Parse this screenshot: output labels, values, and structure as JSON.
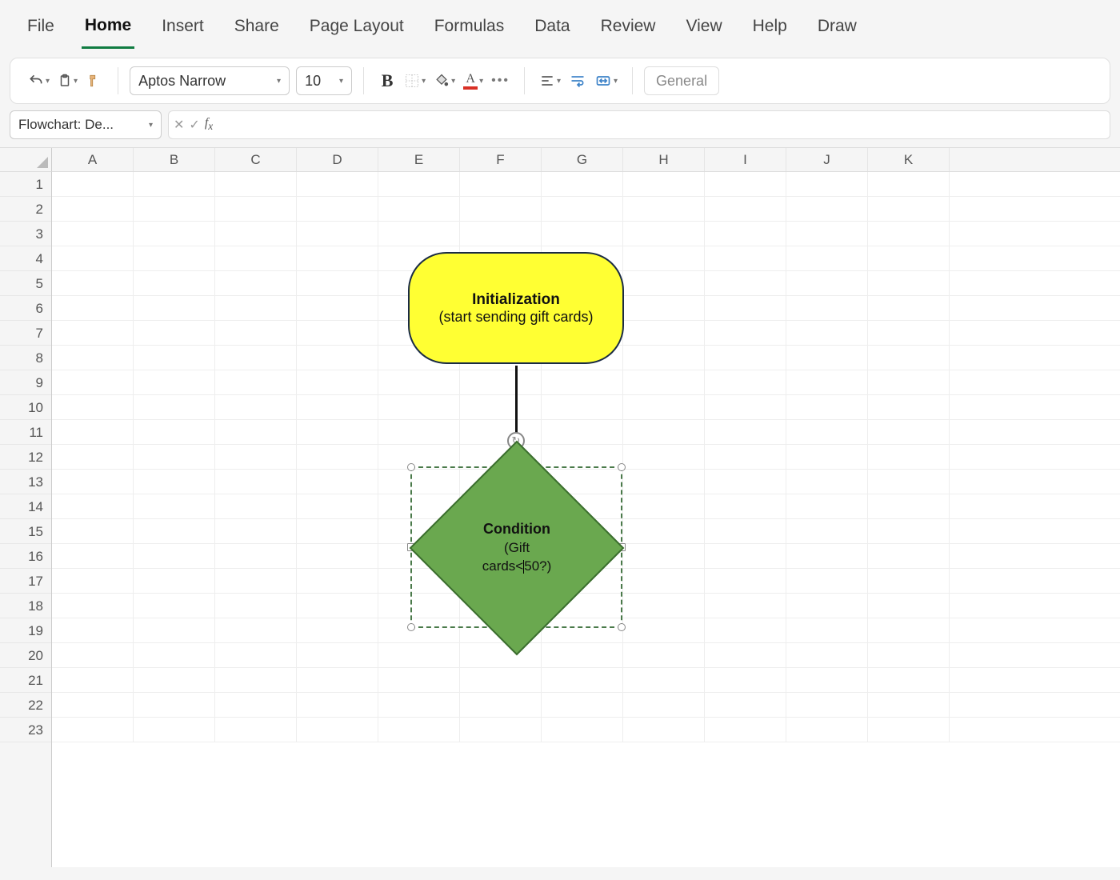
{
  "ribbon": {
    "tabs": [
      "File",
      "Home",
      "Insert",
      "Share",
      "Page Layout",
      "Formulas",
      "Data",
      "Review",
      "View",
      "Help",
      "Draw"
    ],
    "active": "Home"
  },
  "toolbar": {
    "font": "Aptos Narrow",
    "size": "10",
    "number_format": "General"
  },
  "namebox": "Flowchart: De...",
  "formula": "",
  "columns": [
    "A",
    "B",
    "C",
    "D",
    "E",
    "F",
    "G",
    "H",
    "I",
    "J",
    "K"
  ],
  "rows": [
    "1",
    "2",
    "3",
    "4",
    "5",
    "6",
    "7",
    "8",
    "9",
    "10",
    "11",
    "12",
    "13",
    "14",
    "15",
    "16",
    "17",
    "18",
    "19",
    "20",
    "21",
    "22",
    "23"
  ],
  "shapes": {
    "terminator": {
      "title": "Initialization",
      "subtitle": "(start sending gift cards)"
    },
    "decision": {
      "title": "Condition",
      "line2": "(Gift",
      "line3a": "cards<",
      "line3b": "50?)"
    }
  }
}
